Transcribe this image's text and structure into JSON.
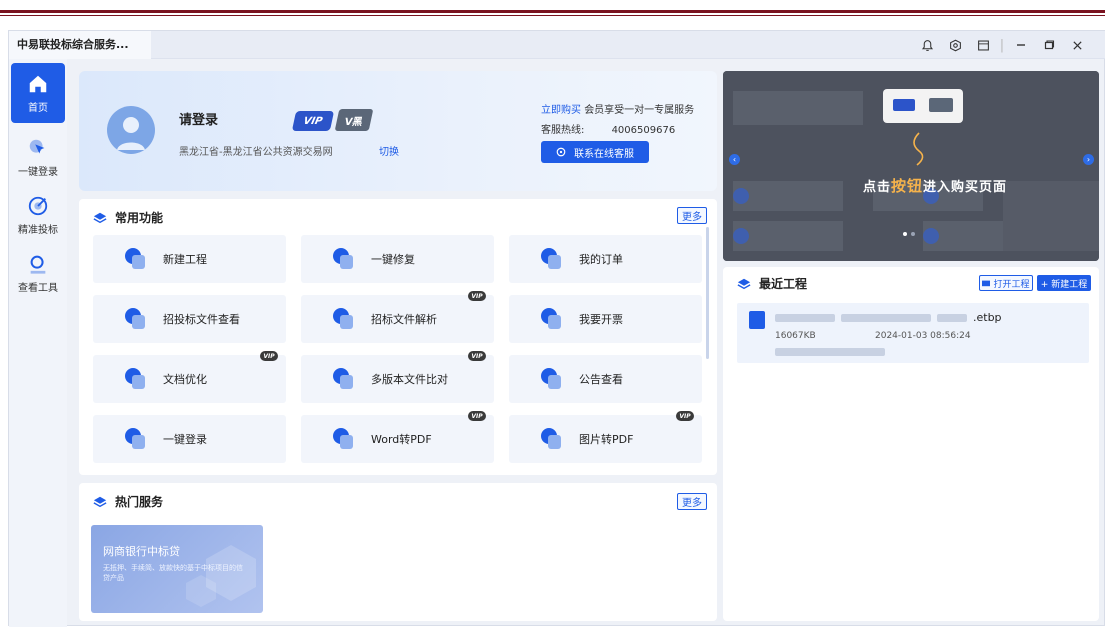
{
  "window": {
    "tab_title": "中易联投标综合服务..."
  },
  "titlebar_icons": [
    "bell-icon",
    "settings-icon",
    "calendar-icon"
  ],
  "sidebar": {
    "items": [
      {
        "label": "首页",
        "icon": "home-icon",
        "active": true
      },
      {
        "label": "一键登录",
        "icon": "cursor-icon",
        "active": false
      },
      {
        "label": "精准投标",
        "icon": "target-icon",
        "active": false
      },
      {
        "label": "查看工具",
        "icon": "search-icon",
        "active": false
      }
    ]
  },
  "login": {
    "title": "请登录",
    "region": "黑龙江省-黑龙江省公共资源交易网",
    "switch": "切换",
    "vip_label": "VIP",
    "vk_label": "V黑",
    "buy_link": "立即购买",
    "buy_text": "会员享受一对一专属服务",
    "hotline_label": "客服热线:",
    "hotline_number": "4006509676",
    "service_button": "联系在线客服"
  },
  "common": {
    "title": "常用功能",
    "more": "更多",
    "items": [
      {
        "label": "新建工程",
        "vip": false
      },
      {
        "label": "一键修复",
        "vip": false
      },
      {
        "label": "我的订单",
        "vip": false
      },
      {
        "label": "招投标文件查看",
        "vip": false
      },
      {
        "label": "招标文件解析",
        "vip": true
      },
      {
        "label": "我要开票",
        "vip": false
      },
      {
        "label": "文档优化",
        "vip": true
      },
      {
        "label": "多版本文件比对",
        "vip": true
      },
      {
        "label": "公告查看",
        "vip": false
      },
      {
        "label": "一键登录",
        "vip": false
      },
      {
        "label": "Word转PDF",
        "vip": true
      },
      {
        "label": "图片转PDF",
        "vip": true
      }
    ],
    "vip_tag": "VIP"
  },
  "hot": {
    "title": "热门服务",
    "more": "更多",
    "card_title": "网商银行中标贷",
    "card_desc": "无抵押、手续简、放款快的基于中标项目的信贷产品"
  },
  "banner": {
    "text_before": "点击",
    "text_highlight": "按钮",
    "text_after": "进入购买页面"
  },
  "recent": {
    "title": "最近工程",
    "open_button": "打开工程",
    "new_button": "+ 新建工程",
    "files": [
      {
        "name_suffix": ".etbp",
        "size": "16067KB",
        "time": "2024-01-03 08:56:24"
      }
    ]
  },
  "colors": {
    "primary": "#1f5ce6",
    "header_rule": "#7a1320",
    "sidebar_active": "#1f5ce6"
  }
}
